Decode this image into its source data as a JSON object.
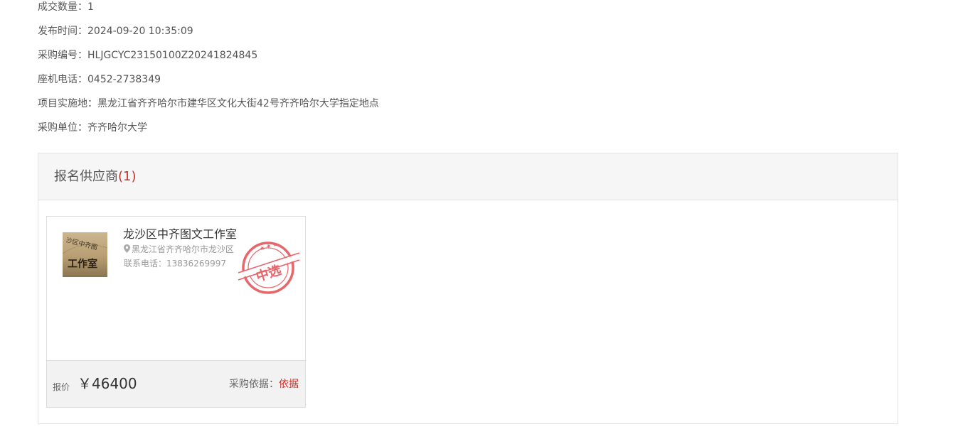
{
  "info": {
    "deal_count_label": "成交数量：",
    "deal_count": "1",
    "publish_time_label": "发布时间：",
    "publish_time": "2024-09-20 10:35:09",
    "purchase_no_label": "采购编号：",
    "purchase_no": "HLJGCYC23150100Z20241824845",
    "phone_label": "座机电话：",
    "phone": "0452-2738349",
    "location_label": "项目实施地：",
    "location": "黑龙江省齐齐哈尔市建华区文化大街42号齐齐哈尔大学指定地点",
    "purchaser_label": "采购单位：",
    "purchaser": "齐齐哈尔大学"
  },
  "suppliers": {
    "title": "报名供应商",
    "count": "(1)",
    "items": [
      {
        "name": "龙沙区中齐图文工作室",
        "address": "黑龙江省齐齐哈尔市龙沙区",
        "phone_label": "联系电话：",
        "phone": "13836269997",
        "stamp_text": "中选",
        "logo_text_top": "沙区中齐图",
        "logo_text_main": "工作室",
        "price_label": "报价",
        "price": "￥46400",
        "basis_label": "采购依据：",
        "basis_link": "依据"
      }
    ]
  },
  "colors": {
    "accent_red": "#c9302c",
    "stamp_red": "#e8666b"
  }
}
